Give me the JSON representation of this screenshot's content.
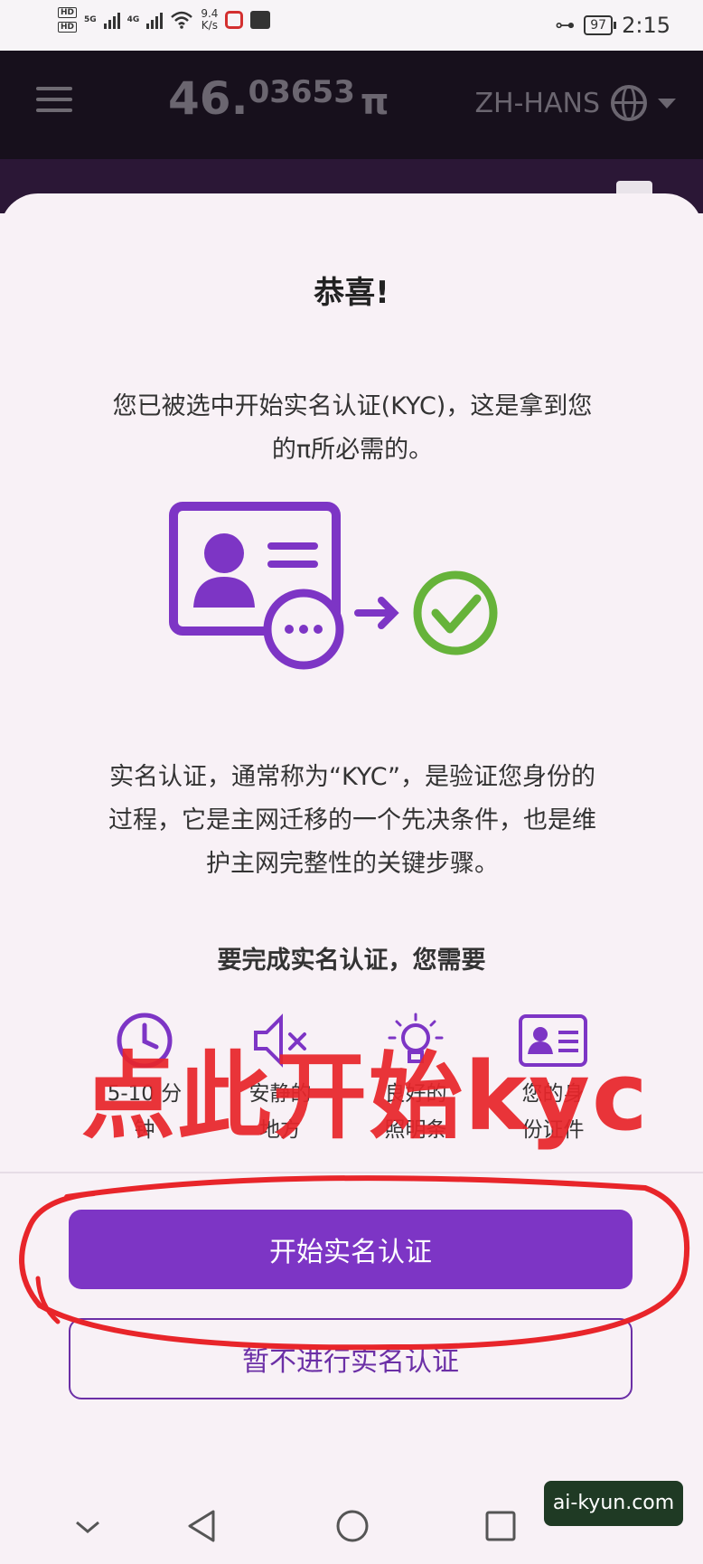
{
  "status_bar": {
    "hd_top": "HD",
    "hd_bottom": "HD",
    "net1": "5G",
    "net2": "4G",
    "speed_value": "9.4",
    "speed_unit": "K/s",
    "battery": "97",
    "time": "2:15"
  },
  "header": {
    "balance_int": "46.",
    "balance_dec": "03653",
    "currency": "π",
    "language": "ZH-HANS"
  },
  "modal": {
    "title": "恭喜!",
    "intro": "您已被选中开始实名认证(KYC)，这是拿到您的π所必需的。",
    "description": "实名认证，通常称为“KYC”，是验证您身份的过程，它是主网迁移的一个先决条件，也是维护主网完整性的关键步骤。",
    "requirements_title": "要完成实名认证，您需要",
    "requirements": [
      {
        "icon": "clock-icon",
        "label": "5-10 分\n钟"
      },
      {
        "icon": "quiet-speaker-icon",
        "label": "安静的\n地方"
      },
      {
        "icon": "lightbulb-icon",
        "label": "良好的\n照明条"
      },
      {
        "icon": "id-card-icon",
        "label": "您的身\n份证件"
      }
    ],
    "start_button": "开始实名认证",
    "skip_button": "暂不进行实名认证"
  },
  "overlay_annotation": "点此开始kyc",
  "watermark": "ai-kyun.com",
  "colors": {
    "primary": "#7d35c5",
    "success": "#66b33a",
    "annotation": "#e8252a",
    "header_bg": "#17101c"
  }
}
